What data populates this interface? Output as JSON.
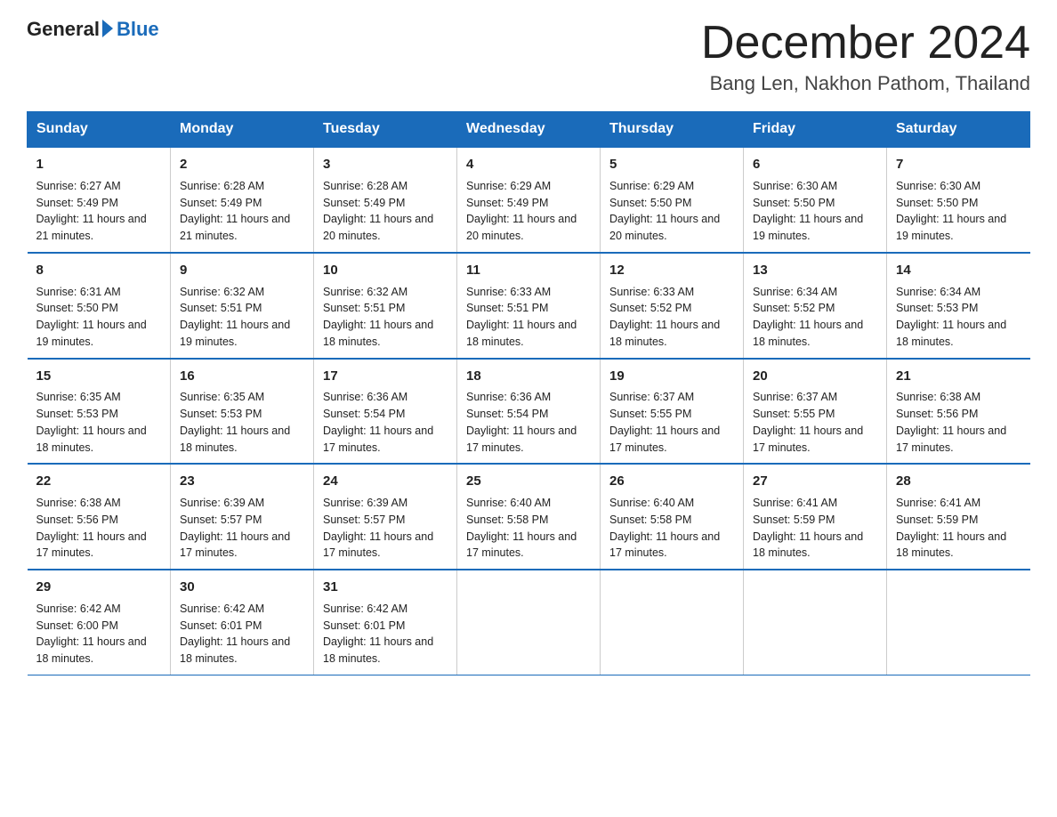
{
  "header": {
    "logo_general": "General",
    "logo_blue": "Blue",
    "month_title": "December 2024",
    "location": "Bang Len, Nakhon Pathom, Thailand"
  },
  "days_of_week": [
    "Sunday",
    "Monday",
    "Tuesday",
    "Wednesday",
    "Thursday",
    "Friday",
    "Saturday"
  ],
  "weeks": [
    [
      {
        "num": "1",
        "sunrise": "6:27 AM",
        "sunset": "5:49 PM",
        "daylight": "11 hours and 21 minutes."
      },
      {
        "num": "2",
        "sunrise": "6:28 AM",
        "sunset": "5:49 PM",
        "daylight": "11 hours and 21 minutes."
      },
      {
        "num": "3",
        "sunrise": "6:28 AM",
        "sunset": "5:49 PM",
        "daylight": "11 hours and 20 minutes."
      },
      {
        "num": "4",
        "sunrise": "6:29 AM",
        "sunset": "5:49 PM",
        "daylight": "11 hours and 20 minutes."
      },
      {
        "num": "5",
        "sunrise": "6:29 AM",
        "sunset": "5:50 PM",
        "daylight": "11 hours and 20 minutes."
      },
      {
        "num": "6",
        "sunrise": "6:30 AM",
        "sunset": "5:50 PM",
        "daylight": "11 hours and 19 minutes."
      },
      {
        "num": "7",
        "sunrise": "6:30 AM",
        "sunset": "5:50 PM",
        "daylight": "11 hours and 19 minutes."
      }
    ],
    [
      {
        "num": "8",
        "sunrise": "6:31 AM",
        "sunset": "5:50 PM",
        "daylight": "11 hours and 19 minutes."
      },
      {
        "num": "9",
        "sunrise": "6:32 AM",
        "sunset": "5:51 PM",
        "daylight": "11 hours and 19 minutes."
      },
      {
        "num": "10",
        "sunrise": "6:32 AM",
        "sunset": "5:51 PM",
        "daylight": "11 hours and 18 minutes."
      },
      {
        "num": "11",
        "sunrise": "6:33 AM",
        "sunset": "5:51 PM",
        "daylight": "11 hours and 18 minutes."
      },
      {
        "num": "12",
        "sunrise": "6:33 AM",
        "sunset": "5:52 PM",
        "daylight": "11 hours and 18 minutes."
      },
      {
        "num": "13",
        "sunrise": "6:34 AM",
        "sunset": "5:52 PM",
        "daylight": "11 hours and 18 minutes."
      },
      {
        "num": "14",
        "sunrise": "6:34 AM",
        "sunset": "5:53 PM",
        "daylight": "11 hours and 18 minutes."
      }
    ],
    [
      {
        "num": "15",
        "sunrise": "6:35 AM",
        "sunset": "5:53 PM",
        "daylight": "11 hours and 18 minutes."
      },
      {
        "num": "16",
        "sunrise": "6:35 AM",
        "sunset": "5:53 PM",
        "daylight": "11 hours and 18 minutes."
      },
      {
        "num": "17",
        "sunrise": "6:36 AM",
        "sunset": "5:54 PM",
        "daylight": "11 hours and 17 minutes."
      },
      {
        "num": "18",
        "sunrise": "6:36 AM",
        "sunset": "5:54 PM",
        "daylight": "11 hours and 17 minutes."
      },
      {
        "num": "19",
        "sunrise": "6:37 AM",
        "sunset": "5:55 PM",
        "daylight": "11 hours and 17 minutes."
      },
      {
        "num": "20",
        "sunrise": "6:37 AM",
        "sunset": "5:55 PM",
        "daylight": "11 hours and 17 minutes."
      },
      {
        "num": "21",
        "sunrise": "6:38 AM",
        "sunset": "5:56 PM",
        "daylight": "11 hours and 17 minutes."
      }
    ],
    [
      {
        "num": "22",
        "sunrise": "6:38 AM",
        "sunset": "5:56 PM",
        "daylight": "11 hours and 17 minutes."
      },
      {
        "num": "23",
        "sunrise": "6:39 AM",
        "sunset": "5:57 PM",
        "daylight": "11 hours and 17 minutes."
      },
      {
        "num": "24",
        "sunrise": "6:39 AM",
        "sunset": "5:57 PM",
        "daylight": "11 hours and 17 minutes."
      },
      {
        "num": "25",
        "sunrise": "6:40 AM",
        "sunset": "5:58 PM",
        "daylight": "11 hours and 17 minutes."
      },
      {
        "num": "26",
        "sunrise": "6:40 AM",
        "sunset": "5:58 PM",
        "daylight": "11 hours and 17 minutes."
      },
      {
        "num": "27",
        "sunrise": "6:41 AM",
        "sunset": "5:59 PM",
        "daylight": "11 hours and 18 minutes."
      },
      {
        "num": "28",
        "sunrise": "6:41 AM",
        "sunset": "5:59 PM",
        "daylight": "11 hours and 18 minutes."
      }
    ],
    [
      {
        "num": "29",
        "sunrise": "6:42 AM",
        "sunset": "6:00 PM",
        "daylight": "11 hours and 18 minutes."
      },
      {
        "num": "30",
        "sunrise": "6:42 AM",
        "sunset": "6:01 PM",
        "daylight": "11 hours and 18 minutes."
      },
      {
        "num": "31",
        "sunrise": "6:42 AM",
        "sunset": "6:01 PM",
        "daylight": "11 hours and 18 minutes."
      },
      null,
      null,
      null,
      null
    ]
  ]
}
